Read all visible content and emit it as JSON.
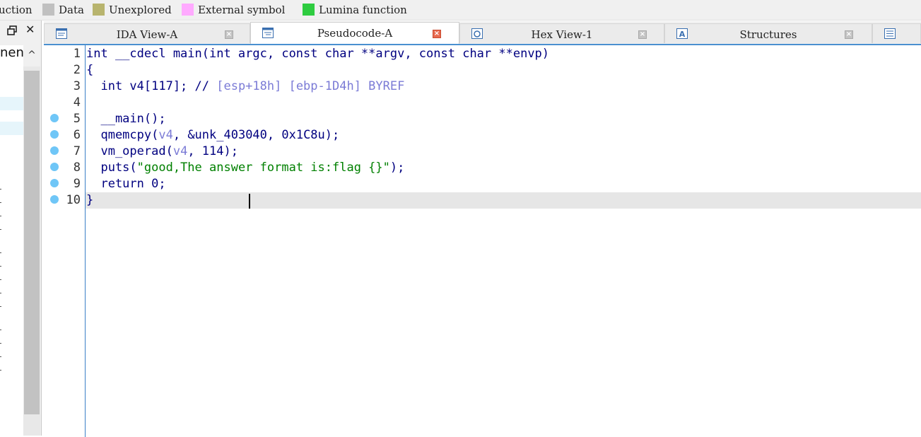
{
  "legend": [
    {
      "label": "uction",
      "color": null
    },
    {
      "label": "Data",
      "color": "#c0c0c0"
    },
    {
      "label": "Unexplored",
      "color": "#b8b46e"
    },
    {
      "label": "External symbol",
      "color": "#ffaaff"
    },
    {
      "label": "Lumina function",
      "color": "#2ecc40"
    }
  ],
  "left_panel": {
    "partial_text": "nen"
  },
  "tabs": [
    {
      "label": "IDA View-A",
      "icon": "ida-view-icon",
      "active": false
    },
    {
      "label": "Pseudocode-A",
      "icon": "pseudocode-icon",
      "active": true
    },
    {
      "label": "Hex View-1",
      "icon": "hex-view-icon",
      "active": false
    },
    {
      "label": "Structures",
      "icon": "structures-icon",
      "active": false
    },
    {
      "label": "",
      "icon": "enums-icon",
      "active": false
    }
  ],
  "code": {
    "line_numbers": [
      "1",
      "2",
      "3",
      "4",
      "5",
      "6",
      "7",
      "8",
      "9",
      "10"
    ],
    "breakpoints": [
      5,
      6,
      7,
      8,
      9,
      10
    ],
    "current_line": 10
  },
  "colors": {
    "keyword": "#000080",
    "comment": "#7b7bd6",
    "string": "#008000",
    "breakpoint": "#6fc6f7",
    "accent": "#3a7fc8"
  }
}
